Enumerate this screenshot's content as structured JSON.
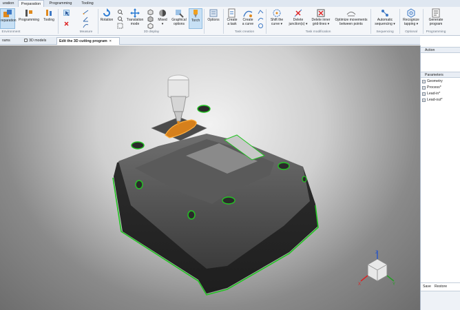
{
  "menu_tabs": [
    "uration",
    "Preparation",
    "Programming",
    "Tooling"
  ],
  "ribbon": {
    "buttons": [
      {
        "label": "reparation",
        "icon": "preparation-icon"
      },
      {
        "label": "Programming",
        "icon": "programming-icon"
      },
      {
        "label": "Tooling",
        "icon": "tooling-icon"
      },
      {
        "label": "Rotation",
        "icon": "rotation-icon"
      },
      {
        "label": "Translation\nmode",
        "icon": "translation-icon"
      },
      {
        "label": "Mixed\n▾",
        "icon": "mixed-icon"
      },
      {
        "label": "Graphical\noptions",
        "icon": "graphical-options-icon"
      },
      {
        "label": "Torch",
        "icon": "torch-icon"
      },
      {
        "label": "Options",
        "icon": "options-icon"
      },
      {
        "label": "Create\na task",
        "icon": "create-task-icon"
      },
      {
        "label": "Create\na curve",
        "icon": "create-curve-icon"
      },
      {
        "label": "Shift the\ncurve ▾",
        "icon": "shift-curve-icon"
      },
      {
        "label": "Delete\njunction(s) ▾",
        "icon": "delete-junction-icon"
      },
      {
        "label": "Delete inner\ngrid-lines ▾",
        "icon": "delete-gridlines-icon"
      },
      {
        "label": "Optimize movements\nbetween points",
        "icon": "optimize-icon"
      },
      {
        "label": "Automatic\nsequencing ▾",
        "icon": "auto-sequencing-icon"
      },
      {
        "label": "Recognize\ntapping ▾",
        "icon": "recognize-tapping-icon"
      },
      {
        "label": "Generate\nprogram",
        "icon": "generate-program-icon"
      }
    ],
    "groups": [
      "Environment",
      "Measure",
      "3D display",
      "Task creation",
      "Task modification",
      "Sequencing",
      "Optional",
      "Programming"
    ]
  },
  "doc_tabs": [
    "rams",
    "3D models",
    "Edit the 3D cutting program"
  ],
  "right_panel": {
    "action_header": "Action",
    "parameters_header": "Parameters",
    "parameters": [
      "Geometry",
      "Process*",
      "Lead-in*",
      "Lead-out*"
    ],
    "save_label": "Save",
    "restore_label": "Restore"
  },
  "viewcube": {
    "axes": [
      "Z",
      "X",
      "Y"
    ]
  },
  "colors": {
    "accent": "#2b579a",
    "toolpath": "#22c422",
    "part": "#3c3c3c",
    "torch_hl": "#f0a020"
  }
}
